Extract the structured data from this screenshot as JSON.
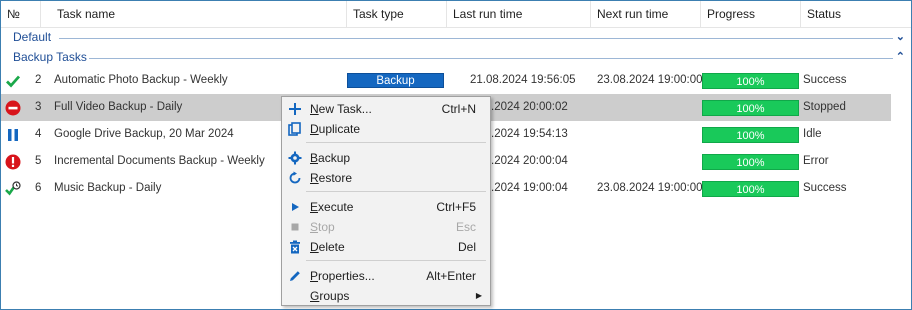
{
  "header": {
    "num": "№",
    "task_name": "Task name",
    "task_type": "Task type",
    "last_run": "Last run time",
    "next_run": "Next run time",
    "progress": "Progress",
    "status": "Status"
  },
  "groups": {
    "default": "Default",
    "backup": "Backup Tasks"
  },
  "rows": [
    {
      "num": "2",
      "name": "Automatic Photo Backup - Weekly",
      "type": "Backup",
      "last": "21.08.2024 19:56:05",
      "next": "23.08.2024 19:00:00",
      "progress": "100%",
      "status": "Success",
      "icon": "check-icon"
    },
    {
      "num": "3",
      "name": "Full Video Backup - Daily",
      "type": "",
      "last": ".2024 20:00:02",
      "next": "",
      "progress": "100%",
      "status": "Stopped",
      "icon": "stop-icon"
    },
    {
      "num": "4",
      "name": "Google Drive Backup, 20 Mar 2024",
      "type": "",
      "last": ".2024 19:54:13",
      "next": "",
      "progress": "100%",
      "status": "Idle",
      "icon": "pause-icon"
    },
    {
      "num": "5",
      "name": "Incremental Documents Backup - Weekly",
      "type": "",
      "last": ".2024 20:00:04",
      "next": "",
      "progress": "100%",
      "status": "Error",
      "icon": "error-icon"
    },
    {
      "num": "6",
      "name": "Music Backup - Daily",
      "type": "",
      "last": ".2024 19:00:04",
      "next": "23.08.2024 19:00:00",
      "progress": "100%",
      "status": "Success",
      "icon": "scheduled-check-icon"
    }
  ],
  "menu": {
    "new_task": {
      "u": "N",
      "rest": "ew Task...",
      "shortcut": "Ctrl+N"
    },
    "duplicate": {
      "u": "D",
      "rest": "uplicate",
      "shortcut": ""
    },
    "backup": {
      "u": "B",
      "rest": "ackup",
      "shortcut": ""
    },
    "restore": {
      "u": "R",
      "rest": "estore",
      "shortcut": ""
    },
    "execute": {
      "u": "E",
      "rest": "xecute",
      "shortcut": "Ctrl+F5"
    },
    "stop": {
      "u": "S",
      "rest": "top",
      "shortcut": "Esc"
    },
    "delete": {
      "u": "D",
      "rest": "elete",
      "shortcut": "Del"
    },
    "properties": {
      "u": "P",
      "rest": "roperties...",
      "shortcut": "Alt+Enter"
    },
    "groups": {
      "u": "G",
      "rest": "roups",
      "shortcut": ""
    }
  },
  "colors": {
    "accent": "#1467c0",
    "progress": "#19c95a",
    "group_text": "#1f4e96",
    "success": "#1aa84a",
    "error": "#d8141b"
  }
}
